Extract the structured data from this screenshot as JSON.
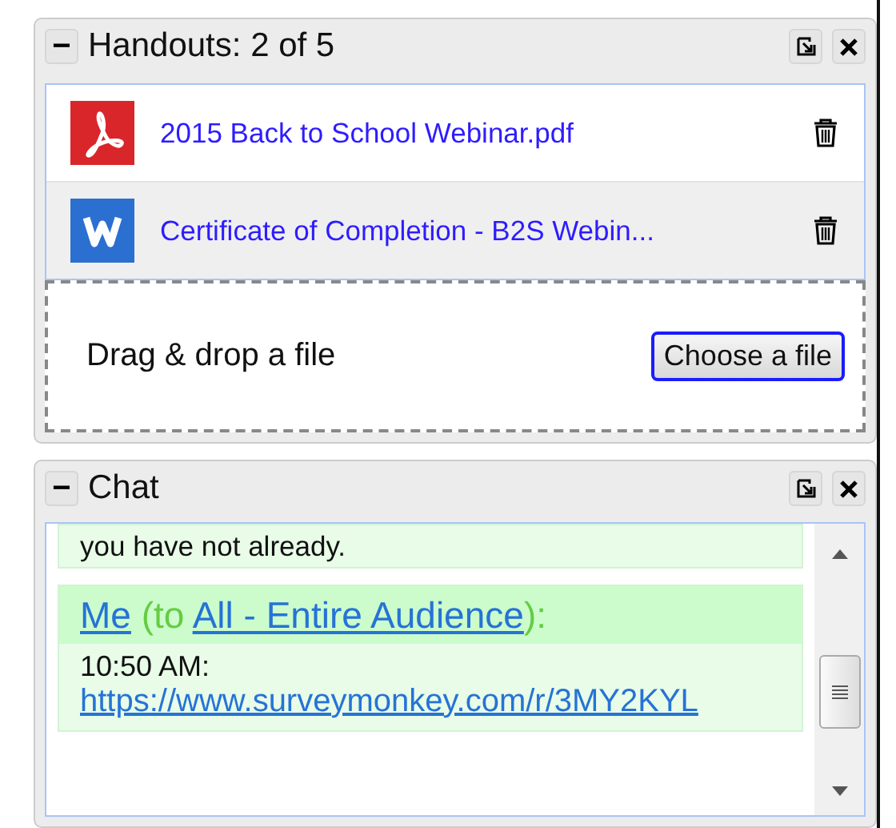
{
  "handouts": {
    "title": "Handouts: 2 of 5",
    "collapse": "−",
    "files": [
      {
        "kind": "pdf",
        "name": "2015 Back to School Webinar.pdf",
        "selected": false
      },
      {
        "kind": "word",
        "name": "Certificate of Completion - B2S Webin...",
        "selected": true
      }
    ],
    "dropzone": {
      "label": "Drag & drop a file",
      "button": "Choose a file"
    }
  },
  "chat": {
    "title": "Chat",
    "collapse": "−",
    "messages": [
      {
        "kind": "partial",
        "text": "you have not already."
      },
      {
        "kind": "full",
        "sender": "Me",
        "to_prefix": "(to ",
        "recipient": "All - Entire Audience",
        "to_suffix": "):",
        "time": "10:50 AM:",
        "link": "https://www.surveymonkey.com/r/3MY2KYL"
      }
    ]
  }
}
